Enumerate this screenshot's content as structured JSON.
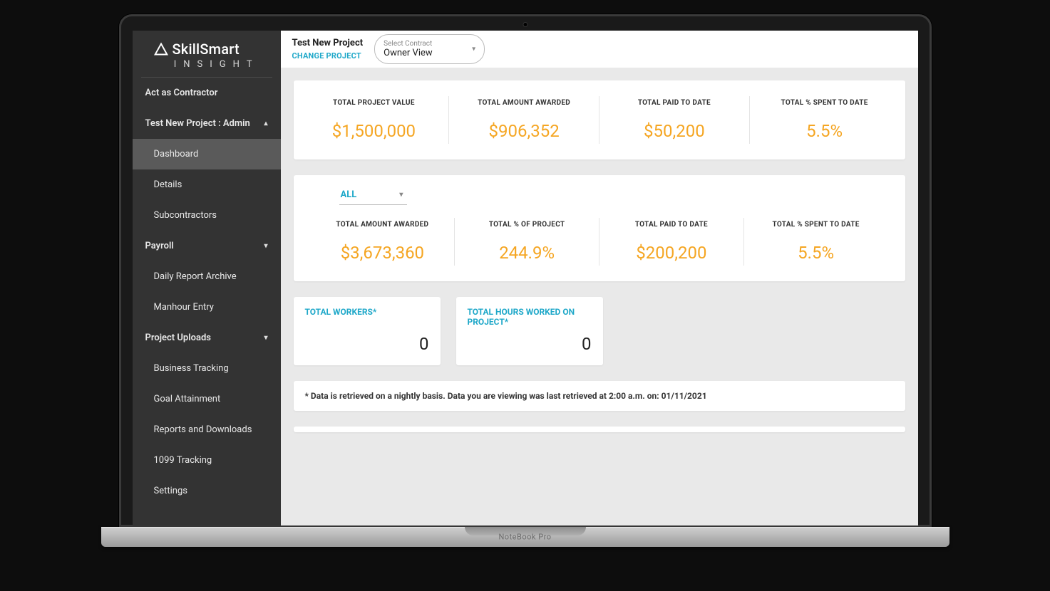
{
  "device": {
    "brand": "NoteBook Pro"
  },
  "logo": {
    "primary": "SkillSmart",
    "secondary": "INSIGHT"
  },
  "sidebar": {
    "act_as": "Act as Contractor",
    "project_admin": "Test New Project : Admin",
    "items": {
      "dashboard": "Dashboard",
      "details": "Details",
      "subcontractors": "Subcontractors",
      "payroll": "Payroll",
      "daily_report": "Daily Report Archive",
      "manhour": "Manhour Entry",
      "project_uploads": "Project Uploads",
      "business_tracking": "Business Tracking",
      "goal_attainment": "Goal Attainment",
      "reports": "Reports and Downloads",
      "tracking_1099": "1099 Tracking",
      "settings": "Settings"
    }
  },
  "topbar": {
    "project_name": "Test New Project",
    "change_project": "CHANGE PROJECT",
    "contract_label": "Select Contract",
    "contract_value": "Owner View"
  },
  "stats_top": [
    {
      "label": "TOTAL PROJECT VALUE",
      "value": "$1,500,000"
    },
    {
      "label": "TOTAL AMOUNT AWARDED",
      "value": "$906,352"
    },
    {
      "label": "TOTAL PAID TO DATE",
      "value": "$50,200"
    },
    {
      "label": "TOTAL % SPENT TO DATE",
      "value": "5.5%"
    }
  ],
  "filter": {
    "value": "ALL"
  },
  "stats_bottom": [
    {
      "label": "TOTAL AMOUNT AWARDED",
      "value": "$3,673,360"
    },
    {
      "label": "TOTAL % OF PROJECT",
      "value": "244.9%"
    },
    {
      "label": "TOTAL PAID TO DATE",
      "value": "$200,200"
    },
    {
      "label": "TOTAL % SPENT TO DATE",
      "value": "5.5%"
    }
  ],
  "mini": [
    {
      "label": "TOTAL WORKERS*",
      "value": "0"
    },
    {
      "label": "TOTAL HOURS WORKED ON PROJECT*",
      "value": "0"
    }
  ],
  "footnote": "* Data is retrieved on a nightly basis. Data you are viewing was last retrieved at 2:00 a.m. on: 01/11/2021"
}
